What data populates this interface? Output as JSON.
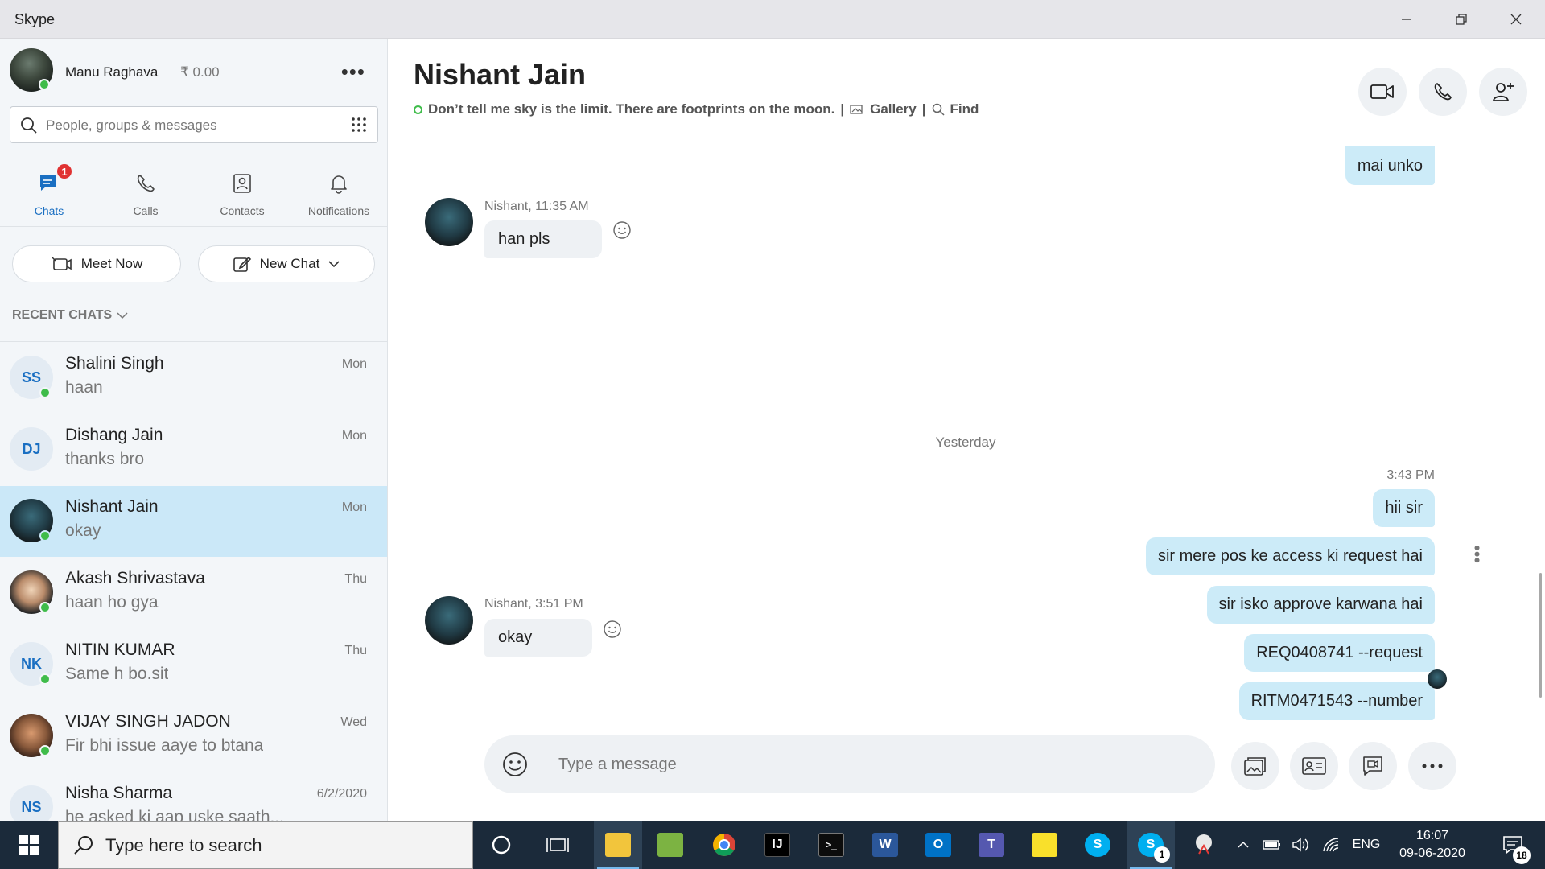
{
  "window": {
    "title": "Skype"
  },
  "colors": {
    "accent": "#1a6fc2",
    "presence": "#3fbc4a",
    "outgoing_bubble": "#ccebf8",
    "incoming_bubble": "#eef1f4",
    "active_chat": "#cbe8f8",
    "taskbar": "#1b2a3a"
  },
  "profile": {
    "name": "Manu Raghava",
    "credit": "₹ 0.00"
  },
  "search": {
    "placeholder": "People, groups & messages"
  },
  "nav": {
    "chats": {
      "label": "Chats",
      "badge": "1"
    },
    "calls": {
      "label": "Calls"
    },
    "contacts": {
      "label": "Contacts"
    },
    "notifications": {
      "label": "Notifications"
    }
  },
  "actions": {
    "meet_now": "Meet Now",
    "new_chat": "New Chat"
  },
  "recent_header": "RECENT CHATS",
  "chats": [
    {
      "name": "Shalini Singh",
      "preview": "haan",
      "time": "Mon",
      "initials": "SS"
    },
    {
      "name": "Dishang Jain",
      "preview": "thanks bro",
      "time": "Mon",
      "initials": "DJ"
    },
    {
      "name": "Nishant Jain",
      "preview": "okay",
      "time": "Mon"
    },
    {
      "name": "Akash Shrivastava",
      "preview": "haan ho gya",
      "time": "Thu"
    },
    {
      "name": "NITIN KUMAR",
      "preview": "Same h bo.sit",
      "time": "Thu",
      "initials": "NK"
    },
    {
      "name": "VIJAY  SINGH JADON",
      "preview": "Fir bhi issue aaye to btana",
      "time": "Wed"
    },
    {
      "name": "Nisha Sharma",
      "preview": "he asked ki aap uske saath...",
      "time": "6/2/2020",
      "initials": "NS"
    }
  ],
  "conversation": {
    "name": "Nishant Jain",
    "mood": "Don’t tell me sky is the limit. There are footprints on the moon.",
    "gallery": "Gallery",
    "find": "Find",
    "separator": "|",
    "messages": {
      "out_top": "mai unko",
      "in1_meta": "Nishant, 11:35 AM",
      "in1_text": "han pls",
      "day": "Yesterday",
      "out_time": "3:43 PM",
      "out1": "hii sir",
      "out2": "sir mere pos ke access ki request hai",
      "out3": "sir isko approve karwana hai",
      "out4": "REQ0408741  --request",
      "out5": "RITM0471543 --number",
      "in2_meta": "Nishant, 3:51 PM",
      "in2_text": "okay"
    },
    "composer_placeholder": "Type a message"
  },
  "taskbar": {
    "search_placeholder": "Type here to search",
    "language": "ENG",
    "time": "16:07",
    "date": "09-06-2020",
    "notification_count": "18",
    "skype_badge": "1"
  }
}
